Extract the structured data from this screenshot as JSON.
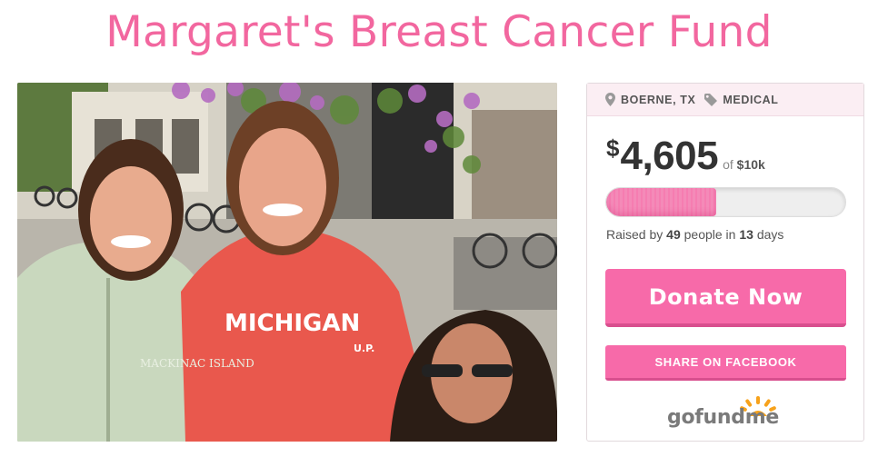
{
  "page": {
    "title": "Margaret's Breast Cancer Fund"
  },
  "photo": {
    "icon": "campaign-photo",
    "jacket_text": "MACKINAC ISLAND",
    "sweatshirt_text": "MICHIGAN",
    "sweatshirt_sub": "U.P."
  },
  "card": {
    "location": "BOERNE, TX",
    "category": "MEDICAL",
    "currency_symbol": "$",
    "amount": "4,605",
    "goal_prefix": "of",
    "goal": "$10k",
    "progress_fraction": 0.4605,
    "raised_prefix": "Raised by",
    "donor_count": "49",
    "raised_middle": "people in",
    "days": "13",
    "raised_suffix": "days",
    "donate_label": "Donate Now",
    "share_label": "SHARE ON FACEBOOK",
    "logo": {
      "go": "go",
      "fund": "fund",
      "me": "me"
    }
  },
  "colors": {
    "brand_pink": "#f2679f",
    "button_pink": "#f76aa9",
    "logo_orange": "#f7a21b"
  }
}
